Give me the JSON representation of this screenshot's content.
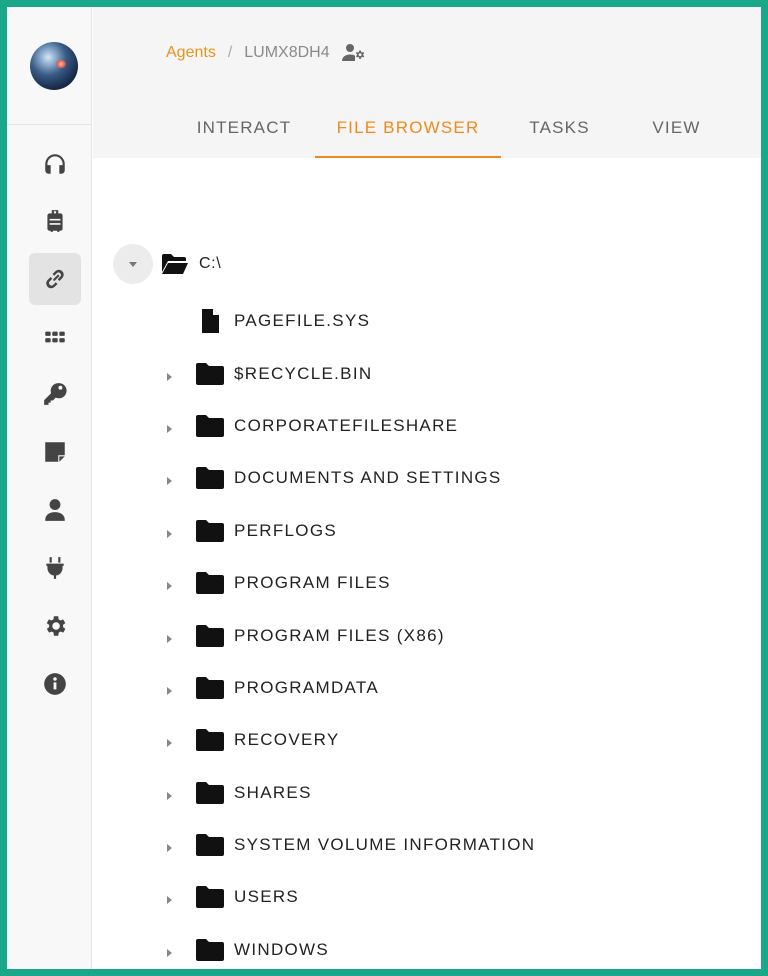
{
  "breadcrumb": {
    "root": "Agents",
    "separator": "/",
    "current": "LUMX8DH4",
    "icon": "user-gear-icon"
  },
  "tabs": [
    {
      "label": "INTERACT",
      "active": false
    },
    {
      "label": "FILE BROWSER",
      "active": true
    },
    {
      "label": "TASKS",
      "active": false
    },
    {
      "label": "VIEW",
      "active": false
    }
  ],
  "sidebar": {
    "items": [
      {
        "icon": "headphones-icon",
        "active": false
      },
      {
        "icon": "suitcase-icon",
        "active": false
      },
      {
        "icon": "link-icon",
        "active": true
      },
      {
        "icon": "grid-icon",
        "active": false
      },
      {
        "icon": "key-icon",
        "active": false
      },
      {
        "icon": "sticky-note-icon",
        "active": false
      },
      {
        "icon": "user-icon",
        "active": false
      },
      {
        "icon": "plug-icon",
        "active": false
      },
      {
        "icon": "gear-icon",
        "active": false
      },
      {
        "icon": "info-icon",
        "active": false
      }
    ]
  },
  "tree": {
    "root": {
      "label": "C:\\",
      "expanded": true,
      "icon": "folder-open-icon"
    },
    "items": [
      {
        "label": "PAGEFILE.SYS",
        "type": "file"
      },
      {
        "label": "$RECYCLE.BIN",
        "type": "folder"
      },
      {
        "label": "CORPORATEFILESHARE",
        "type": "folder"
      },
      {
        "label": "DOCUMENTS AND SETTINGS",
        "type": "folder"
      },
      {
        "label": "PERFLOGS",
        "type": "folder"
      },
      {
        "label": "PROGRAM FILES",
        "type": "folder"
      },
      {
        "label": "PROGRAM FILES (X86)",
        "type": "folder"
      },
      {
        "label": "PROGRAMDATA",
        "type": "folder"
      },
      {
        "label": "RECOVERY",
        "type": "folder"
      },
      {
        "label": "SHARES",
        "type": "folder"
      },
      {
        "label": "SYSTEM VOLUME INFORMATION",
        "type": "folder"
      },
      {
        "label": "USERS",
        "type": "folder"
      },
      {
        "label": "WINDOWS",
        "type": "folder"
      }
    ]
  },
  "colors": {
    "frame": "#1aa78a",
    "accent": "#f08a1c",
    "link": "#e8941a"
  }
}
